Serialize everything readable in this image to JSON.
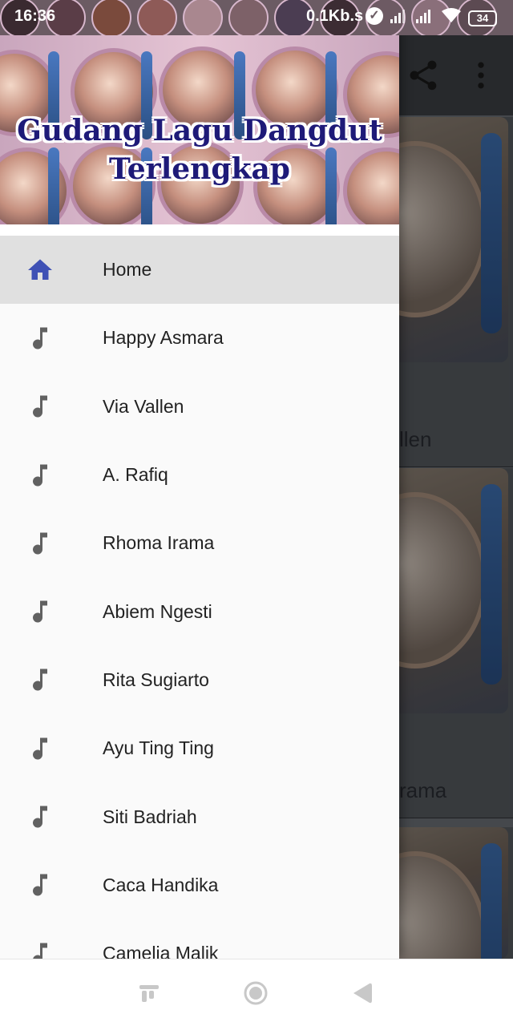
{
  "status_bar": {
    "time": "16:36",
    "network_speed": "0.1Kb.s",
    "battery": "34",
    "icons": [
      "check-circle-icon",
      "signal-icon",
      "signal-icon",
      "wifi-icon",
      "battery-icon"
    ]
  },
  "toolbar": {
    "icons": [
      "share-icon",
      "more-vert-icon"
    ]
  },
  "background_cards": [
    {
      "caption": "llen"
    },
    {
      "caption": "rama"
    }
  ],
  "drawer": {
    "header_title_line1": "Gudang Lagu Dangdut",
    "header_title_line2": "Terlengkap",
    "items": [
      {
        "label": "Home",
        "icon": "home-icon",
        "active": true
      },
      {
        "label": "Happy Asmara",
        "icon": "music-note-icon"
      },
      {
        "label": "Via Vallen",
        "icon": "music-note-icon"
      },
      {
        "label": "A. Rafiq",
        "icon": "music-note-icon"
      },
      {
        "label": "Rhoma Irama",
        "icon": "music-note-icon"
      },
      {
        "label": "Abiem Ngesti",
        "icon": "music-note-icon"
      },
      {
        "label": "Rita Sugiarto",
        "icon": "music-note-icon"
      },
      {
        "label": "Ayu Ting Ting",
        "icon": "music-note-icon"
      },
      {
        "label": "Siti Badriah",
        "icon": "music-note-icon"
      },
      {
        "label": "Caca Handika",
        "icon": "music-note-icon"
      },
      {
        "label": "Camelia Malik",
        "icon": "music-note-icon"
      }
    ]
  },
  "nav_bar": {
    "icons": [
      "recents-icon",
      "home-circle-icon",
      "back-triangle-icon"
    ]
  },
  "colors": {
    "home_icon": "#3f51b5",
    "note_icon": "#616161",
    "active_bg": "#e0e0e0",
    "title": "#1e1a78"
  }
}
